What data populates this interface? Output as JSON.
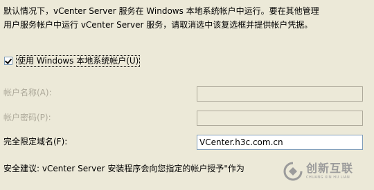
{
  "description": {
    "line1": "默认情况下，vCenter Server 服务在 Windows 本地系统帐户中运行。要在其他管理",
    "line2": "用户服务帐户中运行 vCenter Server 服务，请取消选中该复选框并提供帐户凭据。"
  },
  "use_local_account": {
    "label": "使用 Windows 本地系统帐户(U)",
    "checked": true
  },
  "fields": {
    "account_name": {
      "label": "帐户名称(A):",
      "value": "",
      "enabled": false
    },
    "account_password": {
      "label": "帐户密码(P):",
      "value": "",
      "enabled": false
    },
    "fqdn": {
      "label": "完全限定域名(F):",
      "value": "VCenter.h3c.com.cn",
      "enabled": true
    }
  },
  "security_advice": "安全建议: vCenter Server 安装程序会向您指定的帐户授予\"作为",
  "watermark": {
    "brand": "创新互联",
    "tagline": "CHUANG XIN HU LIAN"
  }
}
